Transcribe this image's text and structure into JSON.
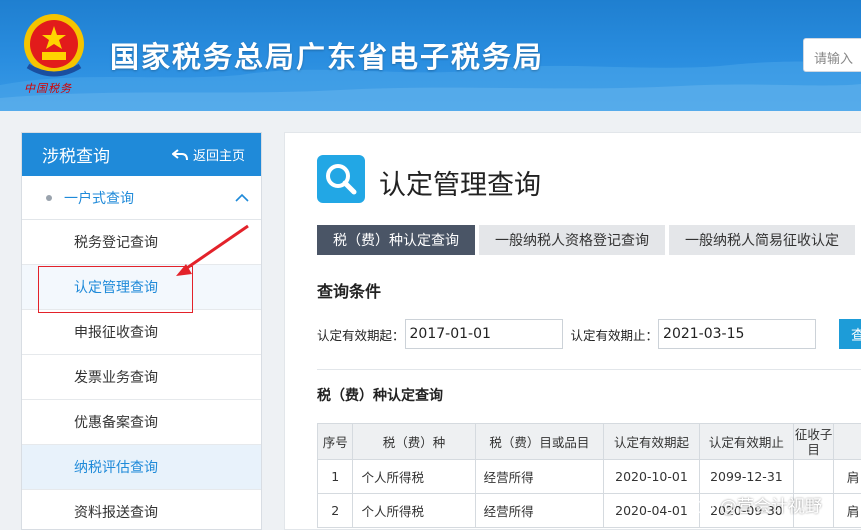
{
  "header": {
    "site_title": "国家税务总局广东省电子税务局",
    "emblem_caption": "中国税务",
    "search_placeholder": "请输入"
  },
  "sidebar": {
    "title": "涉税查询",
    "back_label": "返回主页",
    "group_label": "一户式查询",
    "items": [
      {
        "label": "税务登记查询"
      },
      {
        "label": "认定管理查询"
      },
      {
        "label": "申报征收查询"
      },
      {
        "label": "发票业务查询"
      },
      {
        "label": "优惠备案查询"
      },
      {
        "label": "纳税评估查询"
      },
      {
        "label": "资料报送查询"
      }
    ]
  },
  "main": {
    "page_title": "认定管理查询",
    "tabs": [
      {
        "label": "税（费）种认定查询"
      },
      {
        "label": "一般纳税人资格登记查询"
      },
      {
        "label": "一般纳税人简易征收认定"
      }
    ],
    "query": {
      "section_title": "查询条件",
      "start_label": "认定有效期起：",
      "start_value": "2017-01-01",
      "end_label": "认定有效期止：",
      "end_value": "2021-03-15",
      "button_label": "查"
    },
    "result_title": "税（费）种认定查询",
    "table": {
      "headers": [
        "序号",
        "税（费）种",
        "税（费）目或品目",
        "认定有效期起",
        "认定有效期止",
        "征收子目",
        ""
      ],
      "rows": [
        [
          "1",
          "个人所得税",
          "经营所得",
          "2020-10-01",
          "2099-12-31",
          "",
          "肩"
        ],
        [
          "2",
          "个人所得税",
          "经营所得",
          "2020-04-01",
          "2020-09-30",
          "",
          "肩"
        ]
      ]
    }
  },
  "watermark": "@营会计视野",
  "colors": {
    "brand_blue": "#1f8ad9",
    "tab_active": "#4a5566",
    "highlight_red": "#e3222a"
  }
}
